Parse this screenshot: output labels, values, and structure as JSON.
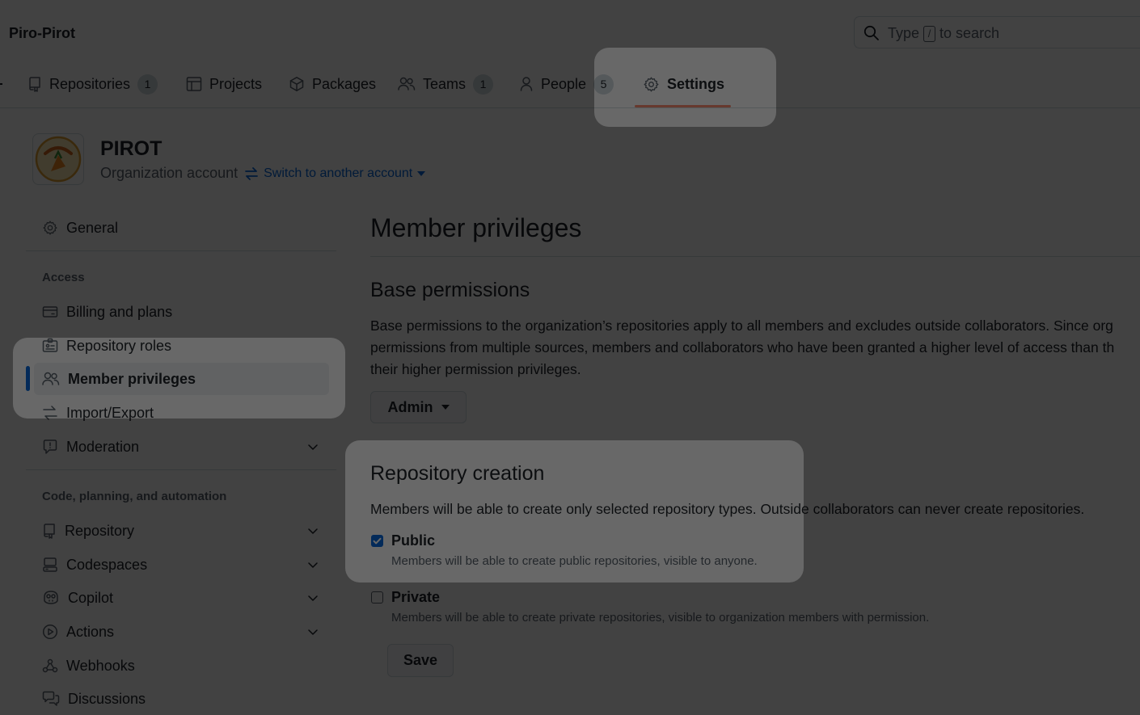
{
  "header": {
    "org_name": "Piro-Pirot",
    "search": {
      "before": "Type",
      "key": "/",
      "after": "to search"
    }
  },
  "tabs": [
    {
      "label": "Repositories",
      "count": "1",
      "icon": "repo-icon"
    },
    {
      "label": "Projects",
      "icon": "table-icon"
    },
    {
      "label": "Packages",
      "icon": "package-icon"
    },
    {
      "label": "Teams",
      "count": "1",
      "icon": "people-icon"
    },
    {
      "label": "People",
      "count": "5",
      "icon": "person-icon"
    },
    {
      "label": "Settings",
      "icon": "gear-icon",
      "active": true
    }
  ],
  "org": {
    "title": "PIROT",
    "subtitle": "Organization account",
    "switch_label": "Switch to another account"
  },
  "sidebar": {
    "general": "General",
    "access_heading": "Access",
    "access_items": [
      "Billing and plans",
      "Repository roles",
      "Member privileges",
      "Import/Export",
      "Moderation"
    ],
    "code_heading": "Code, planning, and automation",
    "code_items": [
      "Repository",
      "Codespaces",
      "Copilot",
      "Actions",
      "Webhooks",
      "Discussions"
    ]
  },
  "main": {
    "title": "Member privileges",
    "base": {
      "heading": "Base permissions",
      "lines": [
        "Base permissions to the organization’s repositories apply to all members and excludes outside collaborators. Since org",
        "permissions from multiple sources, members and collaborators who have been granted a higher level of access than th",
        "their higher permission privileges."
      ],
      "select_value": "Admin"
    },
    "creation": {
      "heading": "Repository creation",
      "description": "Members will be able to create only selected repository types. Outside collaborators can never create repositories.",
      "public_label": "Public",
      "public_checked": true,
      "public_note": "Members will be able to create public repositories, visible to anyone.",
      "private_label": "Private",
      "private_checked": false,
      "private_note": "Members will be able to create private repositories, visible to organization members with permission.",
      "save_label": "Save"
    }
  },
  "colors": {
    "accent": "#0969da",
    "tab_underline": "#fd8c73",
    "muted": "#59636e"
  }
}
